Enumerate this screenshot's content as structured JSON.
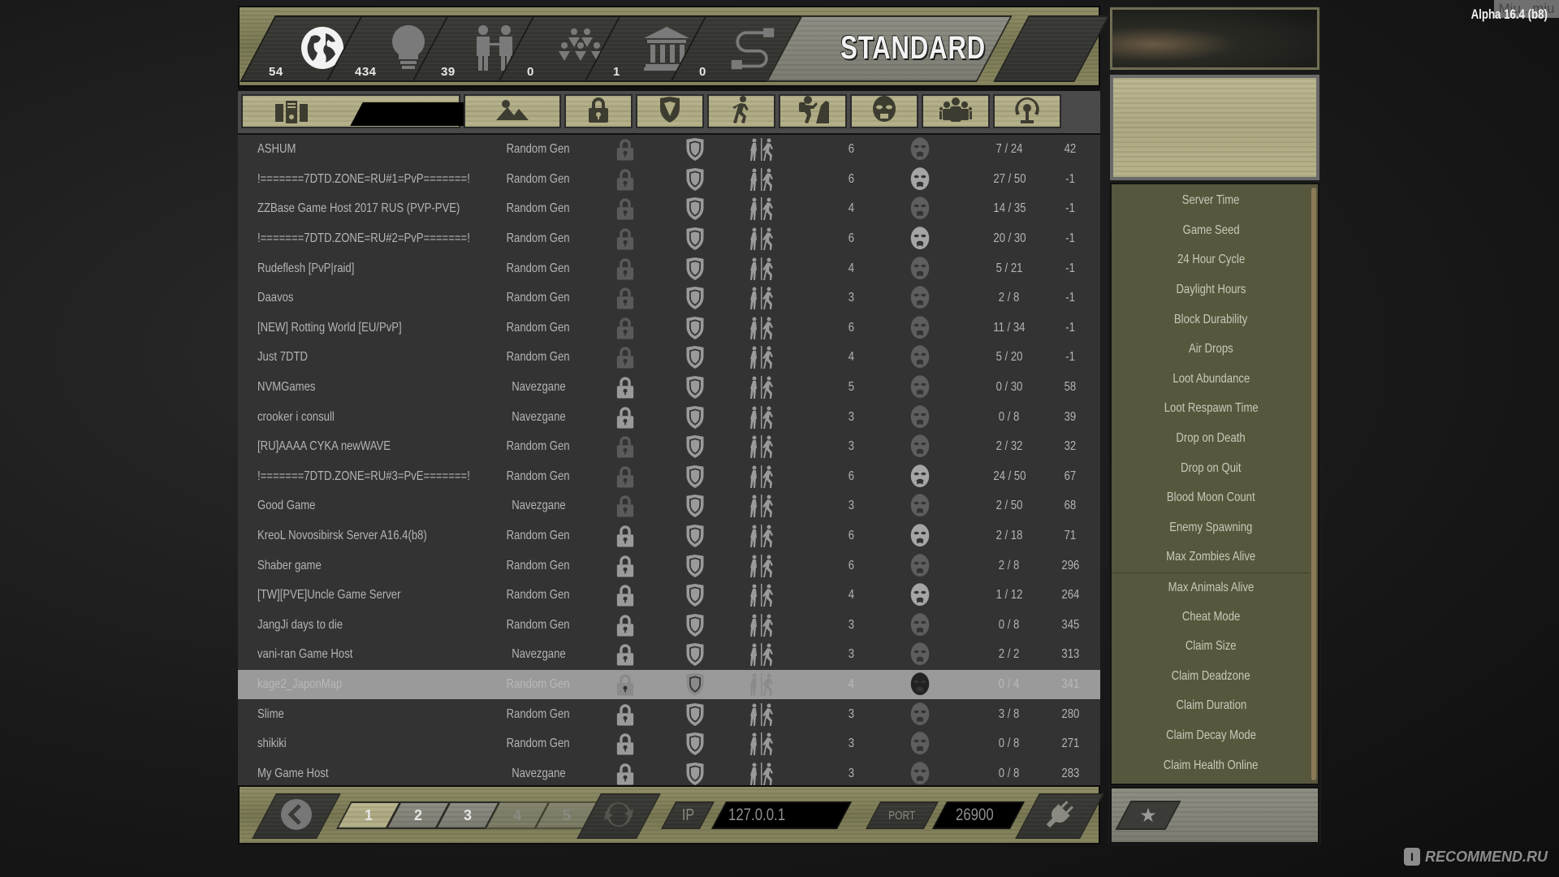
{
  "top_stats": [
    {
      "name": "all-servers",
      "icon": "globe-icon",
      "count": "54"
    },
    {
      "name": "lan-servers",
      "icon": "lightbulb-icon",
      "count": "434"
    },
    {
      "name": "friends-servers",
      "icon": "friends-icon",
      "count": "39"
    },
    {
      "name": "group-servers",
      "icon": "group-icon",
      "count": "0"
    },
    {
      "name": "official-servers",
      "icon": "institution-icon",
      "count": "1"
    },
    {
      "name": "history-servers",
      "icon": "connection-icon",
      "count": "0"
    }
  ],
  "mode_label": "STANDARD",
  "columns": [
    {
      "key": "name",
      "icon": "server-icon"
    },
    {
      "key": "world",
      "icon": "mountain-icon"
    },
    {
      "key": "password",
      "icon": "lock-icon"
    },
    {
      "key": "eac",
      "icon": "shield-icon"
    },
    {
      "key": "pvp",
      "icon": "running-person-icon"
    },
    {
      "key": "difficulty",
      "icon": "climbing-person-icon"
    },
    {
      "key": "zombies",
      "icon": "zombie-head-icon"
    },
    {
      "key": "players",
      "icon": "players-icon"
    },
    {
      "key": "ping",
      "icon": "signal-icon"
    }
  ],
  "search": {
    "value": ""
  },
  "servers": [
    {
      "name": "ASHUM",
      "world": "Random Gen",
      "locked": false,
      "difficulty": "6",
      "zombie_alert": false,
      "players": "7 / 24",
      "ping": "42"
    },
    {
      "name": "!=======7DTD.ZONE=RU#1=PvP=======!",
      "world": "Random Gen",
      "locked": false,
      "difficulty": "6",
      "zombie_alert": true,
      "players": "27 / 50",
      "ping": "-1"
    },
    {
      "name": "ZZBase Game Host 2017 RUS (PVP-PVE)",
      "world": "Random Gen",
      "locked": false,
      "difficulty": "4",
      "zombie_alert": false,
      "players": "14 / 35",
      "ping": "-1"
    },
    {
      "name": "!=======7DTD.ZONE=RU#2=PvP=======!",
      "world": "Random Gen",
      "locked": false,
      "difficulty": "6",
      "zombie_alert": true,
      "players": "20 / 30",
      "ping": "-1"
    },
    {
      "name": "Rudeflesh [PvP|raid]",
      "world": "Random Gen",
      "locked": false,
      "difficulty": "4",
      "zombie_alert": false,
      "players": "5 / 21",
      "ping": "-1"
    },
    {
      "name": "Daavos",
      "world": "Random Gen",
      "locked": false,
      "difficulty": "3",
      "zombie_alert": false,
      "players": "2 / 8",
      "ping": "-1"
    },
    {
      "name": "[NEW] Rotting World [EU/PvP]",
      "world": "Random Gen",
      "locked": false,
      "difficulty": "6",
      "zombie_alert": false,
      "players": "11 / 34",
      "ping": "-1"
    },
    {
      "name": "Just 7DTD",
      "world": "Random Gen",
      "locked": false,
      "difficulty": "4",
      "zombie_alert": false,
      "players": "5 / 20",
      "ping": "-1"
    },
    {
      "name": "NVMGames",
      "world": "Navezgane",
      "locked": true,
      "difficulty": "5",
      "zombie_alert": false,
      "players": "0 / 30",
      "ping": "58"
    },
    {
      "name": "crooker i consull",
      "world": "Navezgane",
      "locked": true,
      "difficulty": "3",
      "zombie_alert": false,
      "players": "0 / 8",
      "ping": "39"
    },
    {
      "name": "[RU]AAAA CYKA newWAVE",
      "world": "Random Gen",
      "locked": false,
      "difficulty": "3",
      "zombie_alert": false,
      "players": "2 / 32",
      "ping": "32"
    },
    {
      "name": "!=======7DTD.ZONE=RU#3=PvE=======!",
      "world": "Random Gen",
      "locked": false,
      "difficulty": "6",
      "zombie_alert": true,
      "players": "24 / 50",
      "ping": "67"
    },
    {
      "name": "Good Game",
      "world": "Navezgane",
      "locked": false,
      "difficulty": "3",
      "zombie_alert": false,
      "players": "2 / 50",
      "ping": "68"
    },
    {
      "name": "KreoL Novosibirsk Server A16.4(b8)",
      "world": "Random Gen",
      "locked": true,
      "difficulty": "6",
      "zombie_alert": true,
      "players": "2 / 18",
      "ping": "71"
    },
    {
      "name": "Shaber game",
      "world": "Random Gen",
      "locked": true,
      "difficulty": "6",
      "zombie_alert": false,
      "players": "2 / 8",
      "ping": "296"
    },
    {
      "name": "[TW][PVE]Uncle Game Server",
      "world": "Random Gen",
      "locked": true,
      "difficulty": "4",
      "zombie_alert": true,
      "players": "1 / 12",
      "ping": "264"
    },
    {
      "name": "JangJi days to die",
      "world": "Random Gen",
      "locked": true,
      "difficulty": "3",
      "zombie_alert": false,
      "players": "0 / 8",
      "ping": "345"
    },
    {
      "name": "vani-ran Game Host",
      "world": "Navezgane",
      "locked": true,
      "difficulty": "3",
      "zombie_alert": false,
      "players": "2 / 2",
      "ping": "313"
    },
    {
      "name": "kage2_JaponMap",
      "world": "Random Gen",
      "locked": true,
      "difficulty": "4",
      "zombie_alert": true,
      "players": "0 / 4",
      "ping": "341",
      "selected": true
    },
    {
      "name": "Slime",
      "world": "Random Gen",
      "locked": true,
      "difficulty": "3",
      "zombie_alert": false,
      "players": "3 / 8",
      "ping": "280"
    },
    {
      "name": "shikiki",
      "world": "Random Gen",
      "locked": true,
      "difficulty": "3",
      "zombie_alert": false,
      "players": "0 / 8",
      "ping": "271"
    },
    {
      "name": "My Game Host",
      "world": "Navezgane",
      "locked": true,
      "difficulty": "3",
      "zombie_alert": false,
      "players": "0 / 8",
      "ping": "283"
    }
  ],
  "pagination": {
    "pages": [
      {
        "label": "1",
        "active": true,
        "enabled": true
      },
      {
        "label": "2",
        "active": false,
        "enabled": true
      },
      {
        "label": "3",
        "active": false,
        "enabled": true
      },
      {
        "label": "4",
        "active": false,
        "enabled": false
      },
      {
        "label": "5",
        "active": false,
        "enabled": false
      }
    ]
  },
  "connect": {
    "ip_label": "IP",
    "ip_value": "127.0.0.1",
    "port_label": "PORT",
    "port_value": "26900"
  },
  "server_settings": [
    "Server Time",
    "Game Seed",
    "24 Hour Cycle",
    "Daylight Hours",
    "Block Durability",
    "Air Drops",
    "Loot Abundance",
    "Loot Respawn Time",
    "Drop on Death",
    "Drop on Quit",
    "Blood Moon Count",
    "Enemy Spawning",
    "Max Zombies Alive",
    "Max Animals Alive",
    "Cheat Mode",
    "Claim Size",
    "Claim Deadzone",
    "Claim Duration",
    "Claim Decay Mode",
    "Claim Health Online"
  ],
  "version": "Alpha 16.4 (b8)",
  "user_badge": "Miu...miu",
  "watermark": "RECOMMEND.RU",
  "colors": {
    "panel_row_bg": "#333333",
    "selected_row_bg": "#9a9a9a",
    "settings_bg": "#57573e",
    "accent_wood": "#b3af87"
  }
}
